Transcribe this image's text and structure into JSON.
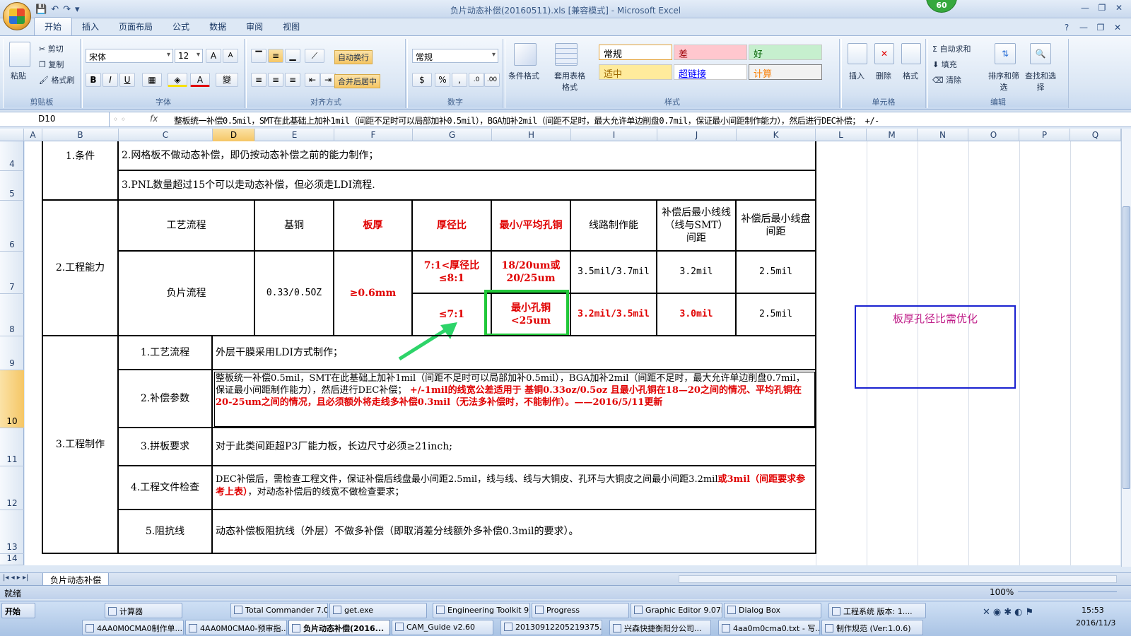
{
  "window": {
    "title": "负片动态补偿(20160511).xls  [兼容模式] - Microsoft Excel",
    "badge": "60"
  },
  "ribbon_tabs": [
    "开始",
    "插入",
    "页面布局",
    "公式",
    "数据",
    "审阅",
    "视图"
  ],
  "clipboard": {
    "paste": "粘贴",
    "cut": "剪切",
    "copy": "复制",
    "format_painter": "格式刷",
    "label": "剪贴板"
  },
  "font": {
    "name": "宋体",
    "size": "12",
    "label": "字体",
    "bold": "B",
    "italic": "I",
    "underline": "U",
    "grow": "A",
    "shrink": "A"
  },
  "alignment": {
    "wrap": "自动换行",
    "merge": "合并后居中",
    "label": "对齐方式"
  },
  "number": {
    "format": "常规",
    "label": "数字",
    "percent": "%",
    "comma": ","
  },
  "styles": {
    "cond_format": "条件格式",
    "table_format": "套用表格格式",
    "cells": [
      "常规",
      "差",
      "好",
      "适中",
      "超链接",
      "计算"
    ],
    "label": "样式"
  },
  "cells_group": {
    "insert": "插入",
    "delete": "删除",
    "format": "格式",
    "label": "单元格"
  },
  "editing": {
    "autosum": "自动求和",
    "fill": "填充",
    "clear": "清除",
    "sort": "排序和筛选",
    "find": "查找和选择",
    "label": "编辑"
  },
  "formula_bar": {
    "name_box": "D10",
    "fx": "fx",
    "content": "整板统一补偿0.5mil，SMT在此基础上加补1mil（间距不足时可以局部加补0.5mil），BGA加补2mil（间距不足时，最大允许单边削盘0.7mil，保证最小间距制作能力），然后进行DEC补偿； +/-"
  },
  "columns": [
    "A",
    "B",
    "C",
    "D",
    "E",
    "F",
    "G",
    "H",
    "I",
    "J",
    "K",
    "L",
    "M",
    "N",
    "O",
    "P",
    "Q"
  ],
  "rows": [
    "4",
    "5",
    "6",
    "7",
    "8",
    "9",
    "10",
    "11",
    "12",
    "13",
    "14"
  ],
  "table": {
    "cond_label": "1.条件",
    "cond_2": "2.网格板不做动态补偿，即仍按动态补偿之前的能力制作；",
    "cond_3": "3.PNL数量超过15个可以走动态补偿，但必须走LDI流程.",
    "eng_cap_label": "2.工程能力",
    "headers": [
      "工艺流程",
      "基铜",
      "板厚",
      "厚径比",
      "最小/平均孔铜",
      "线路制作能",
      "补偿后最小线线（线与SMT）间距",
      "补偿后最小线盘间距"
    ],
    "flow": "负片流程",
    "base_copper": "0.33/0.5OZ",
    "thickness": "≥0.6mm",
    "row1": {
      "ratio": "7:1<厚径比≤8:1",
      "copper": "18/20um或20/25um",
      "line": "3.5mil/3.7mil",
      "min_line": "3.2mil",
      "min_pad": "2.5mil"
    },
    "row2": {
      "ratio": "≤7:1",
      "copper": "最小孔铜<25um",
      "line": "3.2mil/3.5mil",
      "min_line": "3.0mil",
      "min_pad": "2.5mil"
    },
    "eng_make_label": "3.工程制作",
    "items": [
      {
        "label": "1.工艺流程",
        "text": "外层干膜采用LDI方式制作；"
      },
      {
        "label": "2.补偿参数",
        "text_black": "整板统一补偿0.5mil，SMT在此基础上加补1mil（间距不足时可以局部加补0.5mil），BGA加补2mil（间距不足时，最大允许单边削盘0.7mil，保证最小间距制作能力），然后进行DEC补偿；",
        "text_red": " +/-1mil的线宽公差适用于 基铜0.33oz/0.5oz 且最小孔铜在18—20之间的情况、平均孔铜在20-25um之间的情况，且必须额外将走线多补偿0.3mil（无法多补偿时，不能制作）。——2016/5/11更新"
      },
      {
        "label": "3.拼板要求",
        "text": "对于此类间距超P3厂能力板，长边尺寸必须≥21inch;"
      },
      {
        "label": "4.工程文件检查",
        "text_black": "DEC补偿后，需检查工程文件，保证补偿后线盘最小间距2.5mil，线与线、线与大铜皮、孔环与大铜皮之间最小间距3.2mil",
        "text_red": "或3mil（间距要求参考上表）",
        "text_black2": "，对动态补偿后的线宽不做检查要求；"
      },
      {
        "label": "5.阻抗线",
        "text": "动态补偿板阻抗线（外层）不做多补偿（即取消差分线额外多补偿0.3mil的要求）。"
      }
    ],
    "note": "板厚孔径比需优化"
  },
  "sheet_tab": "负片动态补偿",
  "status": {
    "ready": "就绪",
    "zoom": "100%"
  },
  "taskbar": {
    "start": "开始",
    "row1": [
      "计算器",
      "Total Commander 7.0...",
      "get.exe",
      "Engineering Toolkit 9....",
      "Progress",
      "Graphic Editor 9.07b...",
      "Dialog Box",
      "工程系统  版本: 1...."
    ],
    "row2": [
      "4AA0M0CMA0制作单...",
      "4AA0M0CMA0-预审指...",
      "负片动态补偿(2016...",
      "CAM_Guide v2.60",
      "20130912205219375.r...",
      "兴森快捷衡阳分公司...",
      "4aa0m0cma0.txt - 写...",
      "制作规范 (Ver:1.0.6)"
    ],
    "time": "15:53",
    "date": "2016/11/3"
  },
  "colors": {
    "red_text": "#e00000",
    "green_highlight": "#22c83a",
    "note_border": "#1a22d0",
    "note_text": "#c0208a"
  }
}
